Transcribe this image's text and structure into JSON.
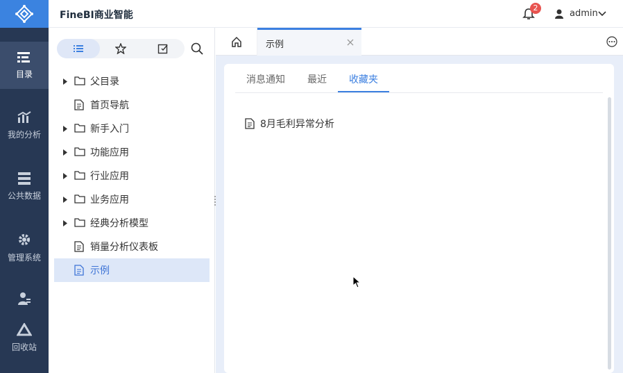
{
  "app": {
    "title": "FineBI商业智能"
  },
  "rail": {
    "items": [
      {
        "label": "目录",
        "icon": "catalog-icon"
      },
      {
        "label": "我的分析",
        "icon": "chart-icon"
      },
      {
        "label": "公共数据",
        "icon": "database-icon"
      },
      {
        "label": "管理系统",
        "icon": "gear-icon"
      },
      {
        "label": "",
        "icon": "user-manage-icon"
      },
      {
        "label": "回收站",
        "icon": "recycle-icon"
      }
    ]
  },
  "header": {
    "notification_count": "2",
    "user": "admin"
  },
  "directory": {
    "items": [
      {
        "label": "父目录",
        "type": "folder"
      },
      {
        "label": "首页导航",
        "type": "file"
      },
      {
        "label": "新手入门",
        "type": "folder"
      },
      {
        "label": "功能应用",
        "type": "folder"
      },
      {
        "label": "行业应用",
        "type": "folder"
      },
      {
        "label": "业务应用",
        "type": "folder"
      },
      {
        "label": "经典分析模型",
        "type": "folder"
      },
      {
        "label": "销量分析仪表板",
        "type": "file"
      },
      {
        "label": "示例",
        "type": "file",
        "selected": true
      }
    ]
  },
  "tabs": {
    "open": [
      {
        "label": "示例"
      }
    ]
  },
  "content": {
    "subtabs": [
      "消息通知",
      "最近",
      "收藏夹"
    ],
    "active_subtab": "收藏夹",
    "favorites": [
      {
        "label": "8月毛利异常分析"
      }
    ]
  },
  "colors": {
    "rail_bg": "#273854",
    "accent": "#3b7fe0",
    "selected_bg": "#dde7f8",
    "badge": "#e85450"
  }
}
